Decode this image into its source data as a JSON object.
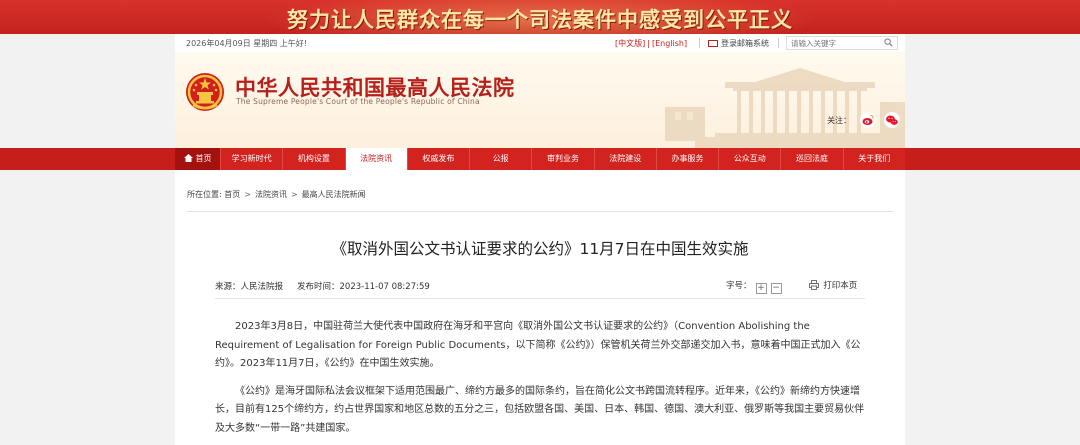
{
  "banner": {
    "slogan": "努力让人民群众在每一个司法案件中感受到公平正义"
  },
  "utility": {
    "date": "2026年04月09日 星期四 上午好!",
    "lang_cn": "[中文版]",
    "lang_en": "[English]",
    "mail": "登录邮箱系统",
    "search_placeholder": "请输入关键字"
  },
  "header": {
    "title_cn": "中华人民共和国最高人民法院",
    "title_en": "The Supreme People's Court of the People's Republic of China",
    "follow_label": "关注："
  },
  "nav": {
    "items": [
      {
        "label": "首页"
      },
      {
        "label": "学习新时代"
      },
      {
        "label": "机构设置"
      },
      {
        "label": "法院资讯"
      },
      {
        "label": "权威发布"
      },
      {
        "label": "公报"
      },
      {
        "label": "审判业务"
      },
      {
        "label": "法院建设"
      },
      {
        "label": "办事服务"
      },
      {
        "label": "公众互动"
      },
      {
        "label": "巡回法庭"
      },
      {
        "label": "关于我们"
      }
    ],
    "active_index": 3
  },
  "breadcrumb": {
    "prefix": "所在位置:",
    "items": [
      "首页",
      "法院资讯",
      "最高人民法院新闻"
    ]
  },
  "article": {
    "title": "《取消外国公文书认证要求的公约》11月7日在中国生效实施",
    "source": "来源：人民法院报",
    "published": "发布时间：2023-11-07 08:27:59",
    "font_size_label": "字号：",
    "increase": "+",
    "decrease": "−",
    "print": "打印本页",
    "paragraphs": [
      "2023年3月8日，中国驻荷兰大使代表中国政府在海牙和平宫向《取消外国公文书认证要求的公约》（Convention Abolishing the Requirement of Legalisation for Foreign Public Documents，以下简称《公约》）保管机关荷兰外交部递交加入书，意味着中国正式加入《公约》。2023年11月7日，《公约》在中国生效实施。",
      "《公约》是海牙国际私法会议框架下适用范围最广、缔约方最多的国际条约，旨在简化公文书跨国流转程序。近年来，《公约》新缔约方快速增长，目前有125个缔约方，约占世界国家和地区总数的五分之三，包括欧盟各国、美国、日本、韩国、德国、澳大利亚、俄罗斯等我国主要贸易伙伴及大多数“一带一路”共建国家。"
    ]
  },
  "colors": {
    "brand_red": "#c61e1b",
    "banner_text": "#fde9a7"
  }
}
